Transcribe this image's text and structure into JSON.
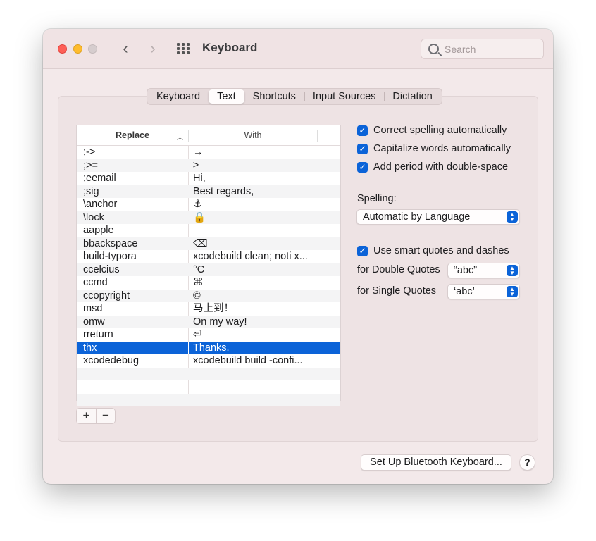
{
  "window": {
    "title": "Keyboard"
  },
  "search": {
    "placeholder": "Search"
  },
  "tabs": [
    {
      "label": "Keyboard",
      "active": false
    },
    {
      "label": "Text",
      "active": true
    },
    {
      "label": "Shortcuts",
      "active": false
    },
    {
      "label": "Input Sources",
      "active": false
    },
    {
      "label": "Dictation",
      "active": false
    }
  ],
  "table": {
    "headers": {
      "replace": "Replace",
      "with": "With"
    },
    "rows": [
      {
        "replace": ";->",
        "with": "→"
      },
      {
        "replace": ";>=",
        "with": "≥"
      },
      {
        "replace": ";eemail",
        "with": "Hi,"
      },
      {
        "replace": ";sig",
        "with": "Best regards,"
      },
      {
        "replace": "\\anchor",
        "with": "⚓"
      },
      {
        "replace": "\\lock",
        "with": "🔒"
      },
      {
        "replace": "aapple",
        "with": ""
      },
      {
        "replace": "bbackspace",
        "with": "⌫"
      },
      {
        "replace": "build-typora",
        "with": "xcodebuild clean; noti x..."
      },
      {
        "replace": "ccelcius",
        "with": "°C"
      },
      {
        "replace": "ccmd",
        "with": "⌘"
      },
      {
        "replace": "ccopyright",
        "with": "©"
      },
      {
        "replace": "msd",
        "with": "马上到！"
      },
      {
        "replace": "omw",
        "with": "On my way!"
      },
      {
        "replace": "rreturn",
        "with": "⏎"
      },
      {
        "replace": "thx",
        "with": "Thanks.",
        "selected": true
      },
      {
        "replace": "xcodedebug",
        "with": "xcodebuild build -confi..."
      },
      {
        "replace": "",
        "with": ""
      },
      {
        "replace": "",
        "with": ""
      },
      {
        "replace": "",
        "with": ""
      }
    ]
  },
  "table_buttons": {
    "add": "+",
    "remove": "−"
  },
  "options": {
    "correct_spelling": "Correct spelling automatically",
    "capitalize_words": "Capitalize words automatically",
    "add_period": "Add period with double-space",
    "spelling_label": "Spelling:",
    "spelling_value": "Automatic by Language",
    "smart_quotes": "Use smart quotes and dashes",
    "double_quotes_label": "for Double Quotes",
    "double_quotes_value": "“abc”",
    "single_quotes_label": "for Single Quotes",
    "single_quotes_value": "‘abc’"
  },
  "footer": {
    "bluetooth_button": "Set Up Bluetooth Keyboard...",
    "help_button": "?"
  },
  "colors": {
    "accent": "#0b63d8",
    "window_bg": "#f3e9ea"
  }
}
